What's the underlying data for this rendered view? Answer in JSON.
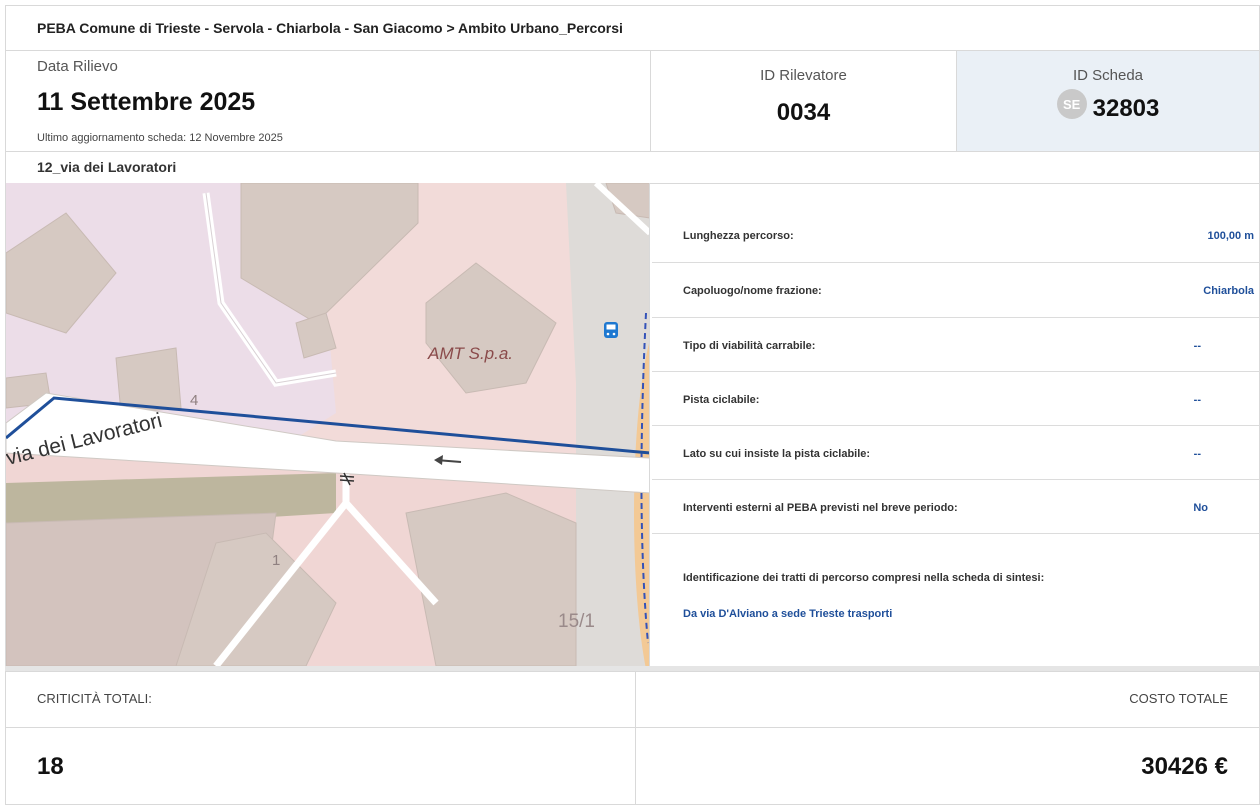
{
  "breadcrumb": "PEBA Comune di Trieste - Servola - Chiarbola - San Giacomo > Ambito Urbano_Percorsi",
  "header": {
    "date_label": "Data Rilievo",
    "date_value": "11 Settembre 2025",
    "updated_text": "Ultimo aggiornamento scheda: 12 Novembre 2025",
    "rilevatore_label": "ID Rilevatore",
    "rilevatore_value": "0034",
    "scheda_label": "ID Scheda",
    "scheda_badge": "SE",
    "scheda_value": "32803"
  },
  "route_name": "12_via dei Lavoratori",
  "map": {
    "street_label": "via dei Lavoratori",
    "poi_label": "AMT S.p.a.",
    "house_numbers": [
      "4",
      "1",
      "15/1"
    ],
    "route_color": "#1f4f9a",
    "icons": [
      "bus-stop-icon",
      "oneway-arrow-icon",
      "no-entry-icon"
    ]
  },
  "details": {
    "rows": [
      {
        "label": "Lunghezza percorso:",
        "value": "100,00 m"
      },
      {
        "label": "Capoluogo/nome frazione:",
        "value": "Chiarbola"
      },
      {
        "label": "Tipo di viabilità carrabile:",
        "value": "--"
      },
      {
        "label": "Pista ciclabile:",
        "value": "--"
      },
      {
        "label": "Lato su cui insiste la pista ciclabile:",
        "value": "--"
      },
      {
        "label": "Interventi esterni al PEBA previsti nel breve periodo:",
        "value": "No"
      }
    ],
    "segments_label": "Identificazione dei tratti di percorso compresi nella scheda di sintesi:",
    "segments_link": "Da via D'Alviano a sede Trieste trasporti"
  },
  "footer": {
    "criticita_label": "CRITICITÀ TOTALI:",
    "criticita_value": "18",
    "costo_label": "COSTO TOTALE",
    "costo_value": "30426 €"
  },
  "colors": {
    "accent": "#1f4f9a",
    "scheda_bg": "#eaf0f6"
  }
}
